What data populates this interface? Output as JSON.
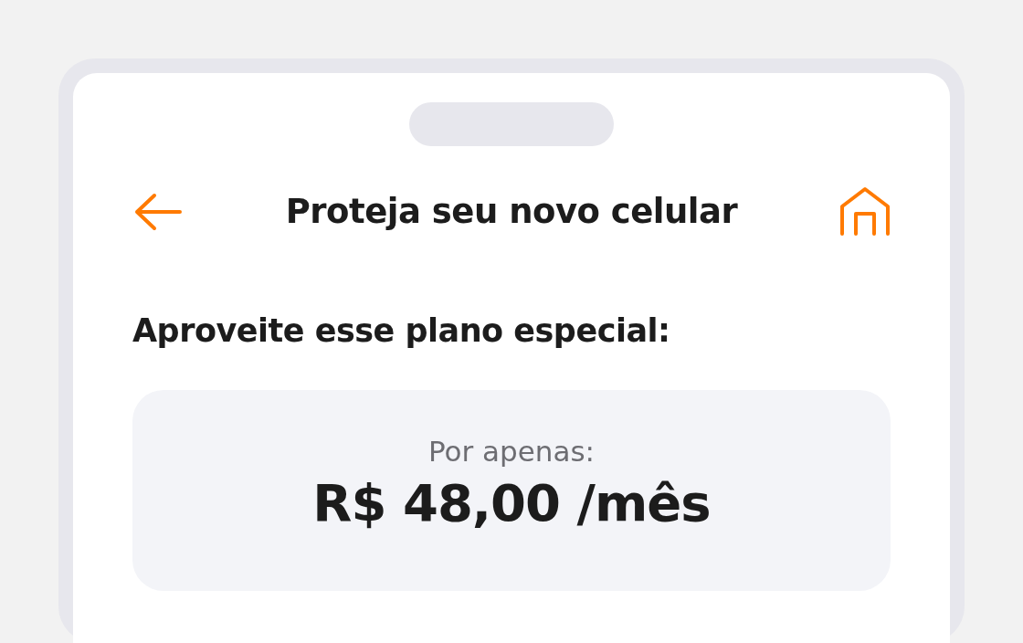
{
  "header": {
    "title": "Proteja seu novo celular"
  },
  "heading": "Aproveite esse plano especial:",
  "plan": {
    "label": "Por apenas:",
    "price": "R$ 48,00 /mês"
  }
}
